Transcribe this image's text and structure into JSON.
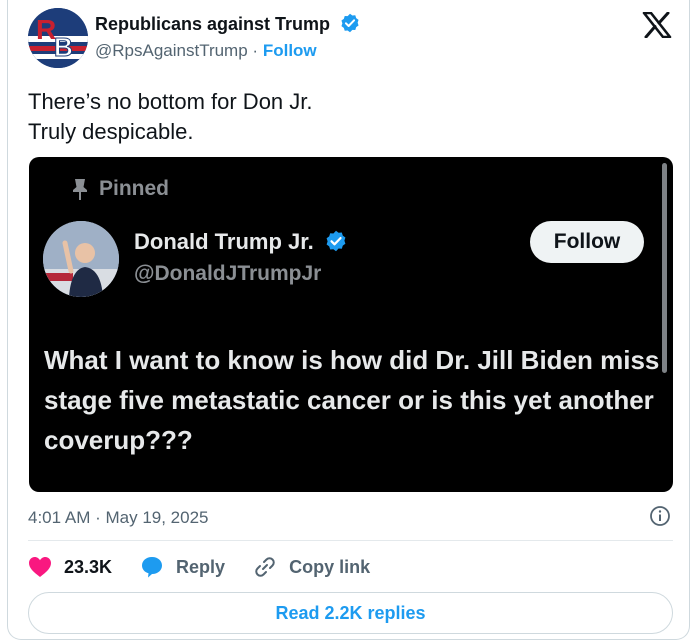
{
  "author": {
    "name": "Republicans against Trump",
    "handle": "@RpsAgainstTrump",
    "separator": "·",
    "follow_label": "Follow",
    "avatar_letters": "RB"
  },
  "tweet": {
    "lines": [
      "There’s no bottom for Don Jr.",
      "Truly despicable."
    ]
  },
  "embedded": {
    "pinned_label": "Pinned",
    "name": "Donald Trump Jr.",
    "handle": "@DonaldJTrumpJr",
    "follow_label": "Follow",
    "text": "What I want to know is how did Dr. Jill Biden miss stage five metastatic cancer or is this yet another coverup???"
  },
  "meta": {
    "timestamp": "4:01 AM · May 19, 2025"
  },
  "actions": {
    "likes": "23.3K",
    "reply_label": "Reply",
    "copy_label": "Copy link"
  },
  "replies_button": "Read 2.2K replies",
  "colors": {
    "accent": "#1d9bf0",
    "like": "#f91880",
    "text": "#0f1419",
    "muted": "#536471"
  },
  "icons": [
    "verified-badge-icon",
    "x-logo-icon",
    "pin-icon",
    "info-icon",
    "heart-icon",
    "reply-bubble-icon",
    "link-icon"
  ]
}
